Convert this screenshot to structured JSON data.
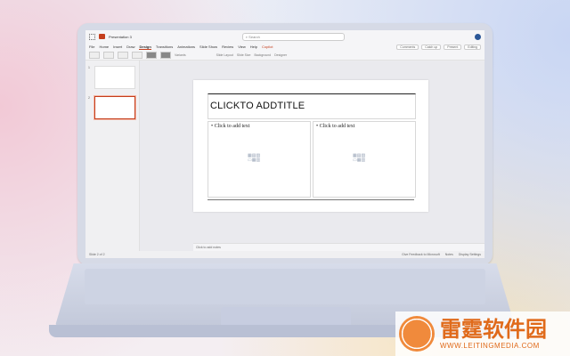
{
  "titlebar": {
    "doc_title": "Presentation 3",
    "search_placeholder": "Search"
  },
  "menu": {
    "tabs": [
      "File",
      "Home",
      "Insert",
      "Draw",
      "Design",
      "Transitions",
      "Animations",
      "Slide Show",
      "Review",
      "View",
      "Help",
      "Copilot"
    ],
    "active": "Design",
    "right": [
      "Comments",
      "Catch up",
      "Present",
      "Editing"
    ]
  },
  "ribbon": {
    "variants_label": "Variants",
    "buttons": [
      "Slide Layout",
      "Slide Size",
      "Background",
      "Designer"
    ]
  },
  "slides_panel": {
    "numbers": [
      "1",
      "2"
    ]
  },
  "slide": {
    "title": "CLICKTO ADDTITLE",
    "left_placeholder": "Click to add text",
    "right_placeholder": "Click to add text"
  },
  "notes": {
    "placeholder": "Click to add notes"
  },
  "status": {
    "slide_of": "Slide 2 of 2",
    "right": [
      "Give Feedback to Microsoft",
      "Notes",
      "Display Settings"
    ]
  },
  "watermark": {
    "cn": "雷霆软件园",
    "url": "WWW.LEITINGMEDIA.COM"
  },
  "colors": {
    "accent": "#c43e1c",
    "avatar": "#2b5797",
    "watermark": "#e06a1a"
  }
}
